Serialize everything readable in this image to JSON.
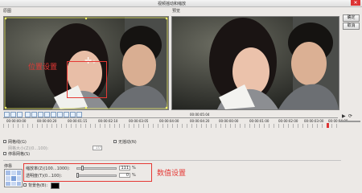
{
  "window": {
    "title": "视频摇动和缩放"
  },
  "buttons": {
    "ok": "确定",
    "cancel": "取消"
  },
  "panels": {
    "left_label": "原图",
    "right_label": "预览"
  },
  "timecodes": {
    "left": [
      "00:00:00:00",
      "00:00:00:20",
      "00:00:01:15",
      "00:00:02:10",
      "00:00:03:05",
      "00:00:04:00",
      "00:00:04:20"
    ],
    "center": "00:00:05:04",
    "right": [
      "00:00:00:00",
      "00:00:01:00",
      "00:00:02:00",
      "00:00:03:00",
      "00:00:04:00"
    ]
  },
  "options": {
    "grid": "网格线(G)",
    "grid_size_label": "网格大小(Z)(0...100):",
    "grid_size_value": "10",
    "snap_to_grid": "停靠网格(S)",
    "no_zoom": "无摇动(N)"
  },
  "section_label": "停靠",
  "zoom": {
    "label": "缩放率(Z)(100...1000):",
    "value": "111",
    "unit": "%"
  },
  "opacity": {
    "label": "透明度(T)(0...100):",
    "value": "0",
    "unit": "%"
  },
  "bg_color_label": "背景色(B):",
  "annotations": {
    "position": "位置设置",
    "values": "数值设置"
  },
  "colors": {
    "accent_red": "#e53935"
  }
}
